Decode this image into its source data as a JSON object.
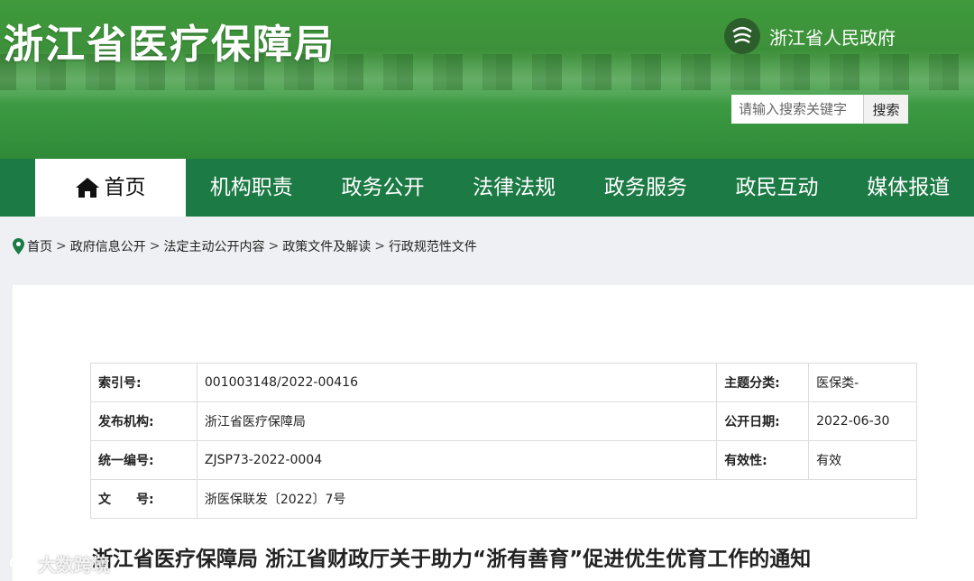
{
  "header": {
    "site_title": "浙江省医疗保障局",
    "gov_link": "浙江省人民政府",
    "search_placeholder": "请输入搜索关键字",
    "search_button": "搜索"
  },
  "nav": {
    "items": [
      {
        "label": "首页",
        "active": true
      },
      {
        "label": "机构职责"
      },
      {
        "label": "政务公开"
      },
      {
        "label": "法律法规"
      },
      {
        "label": "政务服务"
      },
      {
        "label": "政民互动"
      },
      {
        "label": "媒体报道"
      }
    ]
  },
  "breadcrumb": [
    "首页",
    "政府信息公开",
    "法定主动公开内容",
    "政策文件及解读",
    "行政规范性文件"
  ],
  "meta": {
    "index_label": "索引号:",
    "index_value": "001003148/2022-00416",
    "topic_label": "主题分类:",
    "topic_value": "医保类-",
    "issuer_label": "发布机构:",
    "issuer_value": "浙江省医疗保障局",
    "date_label": "公开日期:",
    "date_value": "2022-06-30",
    "code_label": "统一编号:",
    "code_value": "ZJSP73-2022-0004",
    "validity_label": "有效性:",
    "validity_value": "有效",
    "doc_label": "文　　号:",
    "doc_value": "浙医保联发〔2022〕7号"
  },
  "doc_title": "浙江省医疗保障局 浙江省财政厅关于助力“浙有善育”促进优生优育工作的通知",
  "watermark": "大数跨境",
  "colors": {
    "nav_bg": "#1c7a45",
    "header_green": "#3c8f39"
  }
}
